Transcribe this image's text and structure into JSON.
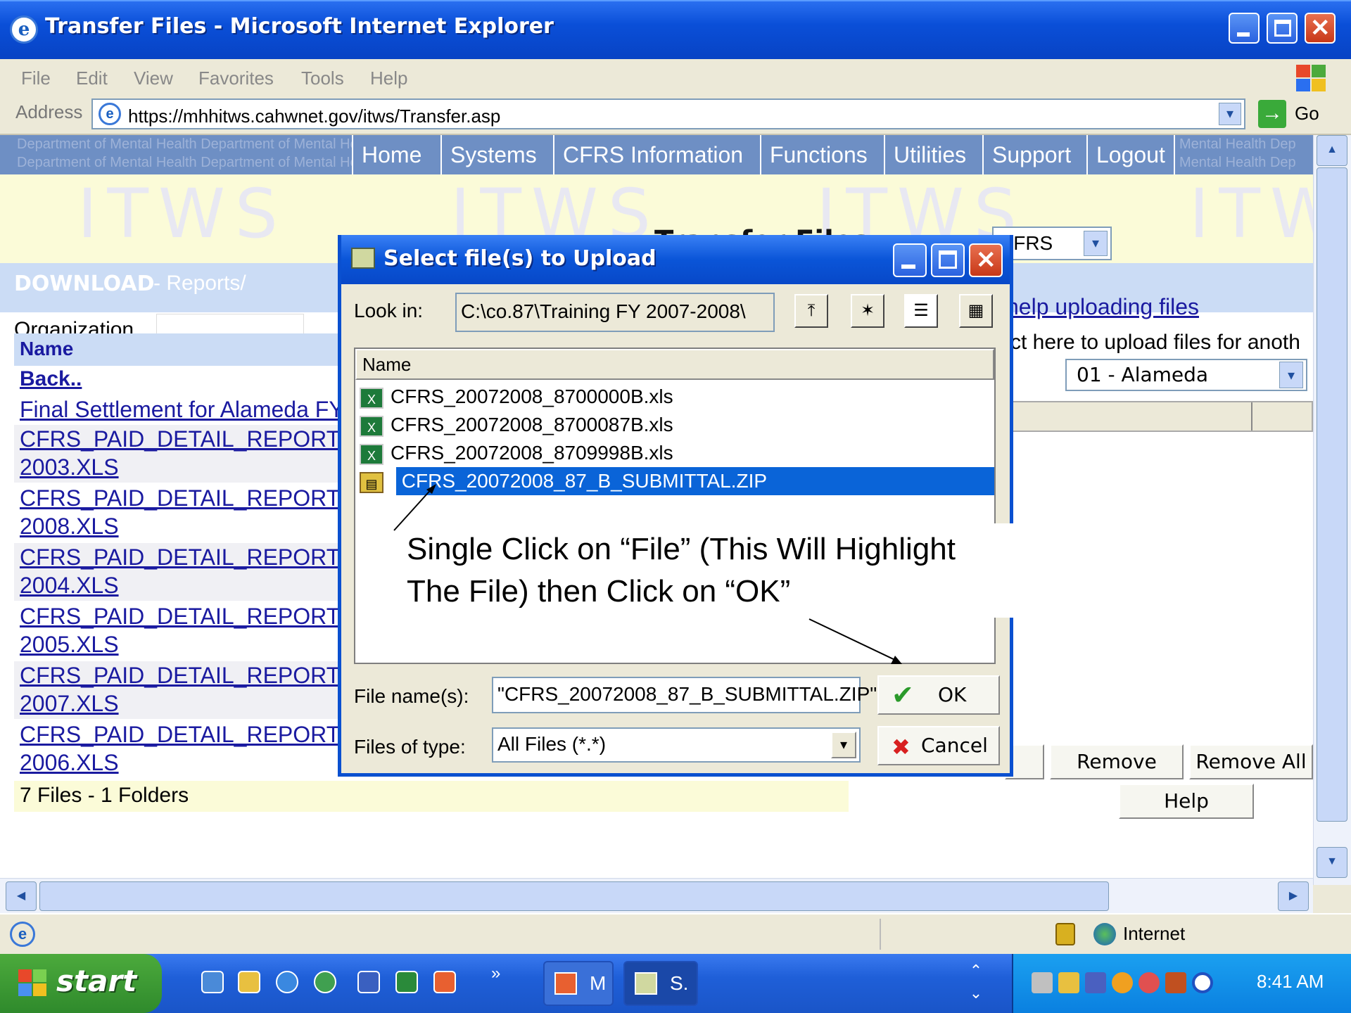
{
  "window": {
    "title": "Transfer Files - Microsoft Internet Explorer"
  },
  "menu": [
    "File",
    "Edit",
    "View",
    "Favorites",
    "Tools",
    "Help"
  ],
  "address": {
    "label": "Address",
    "url": "https://mhhitws.cahwnet.gov/itws/Transfer.asp",
    "go": "Go"
  },
  "site": {
    "dept_text": "Department of Mental Health  Department of Mental Health",
    "dept_right": "Mental Health  Dep",
    "nav": [
      "Home",
      "Systems",
      "CFRS Information",
      "Functions",
      "Utilities",
      "Support",
      "Logout"
    ],
    "watermark": "ITWS",
    "page_title": "Transfer Files"
  },
  "left": {
    "download": "DOWNLOAD",
    "download_path": " - Reports/",
    "organization_label": "Organization",
    "name_header": "Name",
    "back": "Back..",
    "files": [
      {
        "line1": "Final Settlement for Alameda FY",
        "line2": ""
      },
      {
        "line1": "CFRS_PAID_DETAIL_REPORT_",
        "line2": "2003.XLS"
      },
      {
        "line1": "CFRS_PAID_DETAIL_REPORT_",
        "line2": "2008.XLS"
      },
      {
        "line1": "CFRS_PAID_DETAIL_REPORT_",
        "line2": "2004.XLS"
      },
      {
        "line1": "CFRS_PAID_DETAIL_REPORT_",
        "line2": "2005.XLS"
      },
      {
        "line1": "CFRS_PAID_DETAIL_REPORT_",
        "line2": "2007.XLS"
      },
      {
        "line1": "CFRS_PAID_DETAIL_REPORT_",
        "line2": "2006.XLS"
      }
    ],
    "summary": "7 Files - 1 Folders"
  },
  "right": {
    "system_select": "CFRS",
    "help_uploading": "help uploading files",
    "upload_other": "ct here to upload files for anoth",
    "county_select": "01 - Alameda",
    "remove": "Remove",
    "remove_all": "Remove All",
    "help": "Help"
  },
  "dialog": {
    "title": "Select file(s) to Upload",
    "look_in_label": "Look in:",
    "look_in_value": "C:\\co.87\\Training FY 2007-2008\\",
    "name_col": "Name",
    "files": [
      {
        "name": "CFRS_20072008_8700000B.xls",
        "selected": false
      },
      {
        "name": "CFRS_20072008_8700087B.xls",
        "selected": false
      },
      {
        "name": "CFRS_20072008_8709998B.xls",
        "selected": false
      },
      {
        "name": "CFRS_20072008_87_B_SUBMITTAL.ZIP",
        "selected": true
      }
    ],
    "file_name_label": "File name(s):",
    "file_name_value": "\"CFRS_20072008_87_B_SUBMITTAL.ZIP\"",
    "file_type_label": "Files of type:",
    "file_type_value": "All Files (*.*)",
    "ok": "OK",
    "cancel": "Cancel"
  },
  "callout": {
    "line1": "Single Click on “File” (This Will Highlight",
    "line2": "The File)  then Click on “OK”"
  },
  "status": {
    "zone": "Internet"
  },
  "taskbar": {
    "start": "start",
    "tasks": [
      "M",
      "S."
    ],
    "clock": "8:41 AM"
  },
  "colors": {
    "selection": "#0a64d8",
    "link": "#1a1aa0",
    "accent": "#0a50d0"
  }
}
